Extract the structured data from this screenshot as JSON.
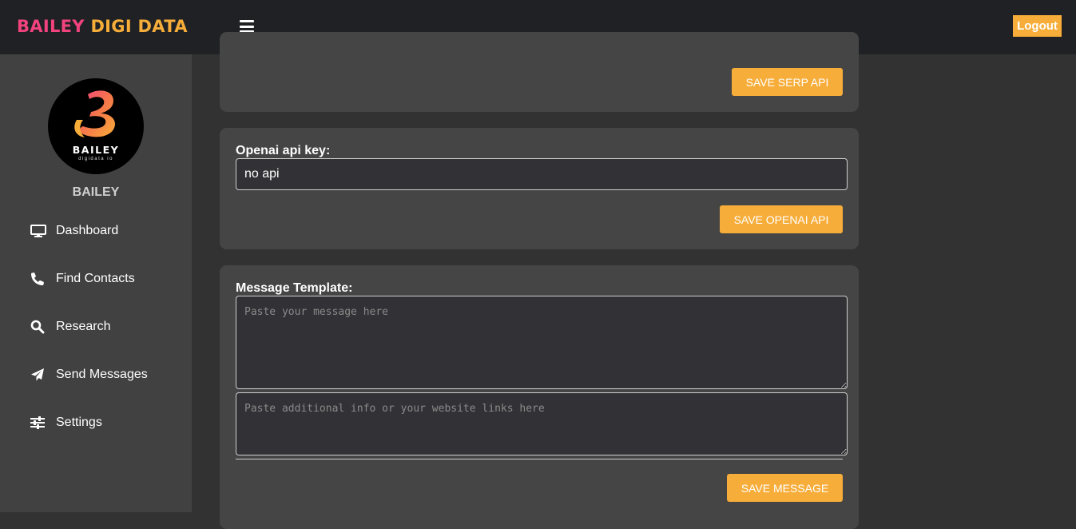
{
  "brand": {
    "part1": "BAILEY",
    "part2": "DIGI DATA"
  },
  "header": {
    "menu_icon": "hamburger-icon",
    "logout_label": "Logout"
  },
  "sidebar": {
    "avatar": {
      "logo_text": "BAILEY",
      "logo_subtext": "digidata io"
    },
    "username": "BAILEY",
    "items": [
      {
        "label": "Dashboard",
        "icon": "monitor-icon"
      },
      {
        "label": "Find Contacts",
        "icon": "phone-icon"
      },
      {
        "label": "Research",
        "icon": "search-icon"
      },
      {
        "label": "Send Messages",
        "icon": "paper-plane-icon"
      },
      {
        "label": "Settings",
        "icon": "sliders-icon"
      }
    ]
  },
  "serp_card": {
    "button_label": "SAVE SERP API"
  },
  "openai_card": {
    "label": "Openai api key:",
    "value": "no api",
    "button_label": "SAVE OPENAI API"
  },
  "message_card": {
    "label": "Message Template:",
    "message_placeholder": "Paste your message here",
    "info_placeholder": "Paste additional info or your website links here",
    "button_label": "SAVE MESSAGE"
  },
  "colors": {
    "accent": "#f7ad3a",
    "brand_pink": "#f2437e",
    "topbar": "#202124",
    "sidebar": "#414141",
    "card": "#454545",
    "background": "#323232"
  }
}
